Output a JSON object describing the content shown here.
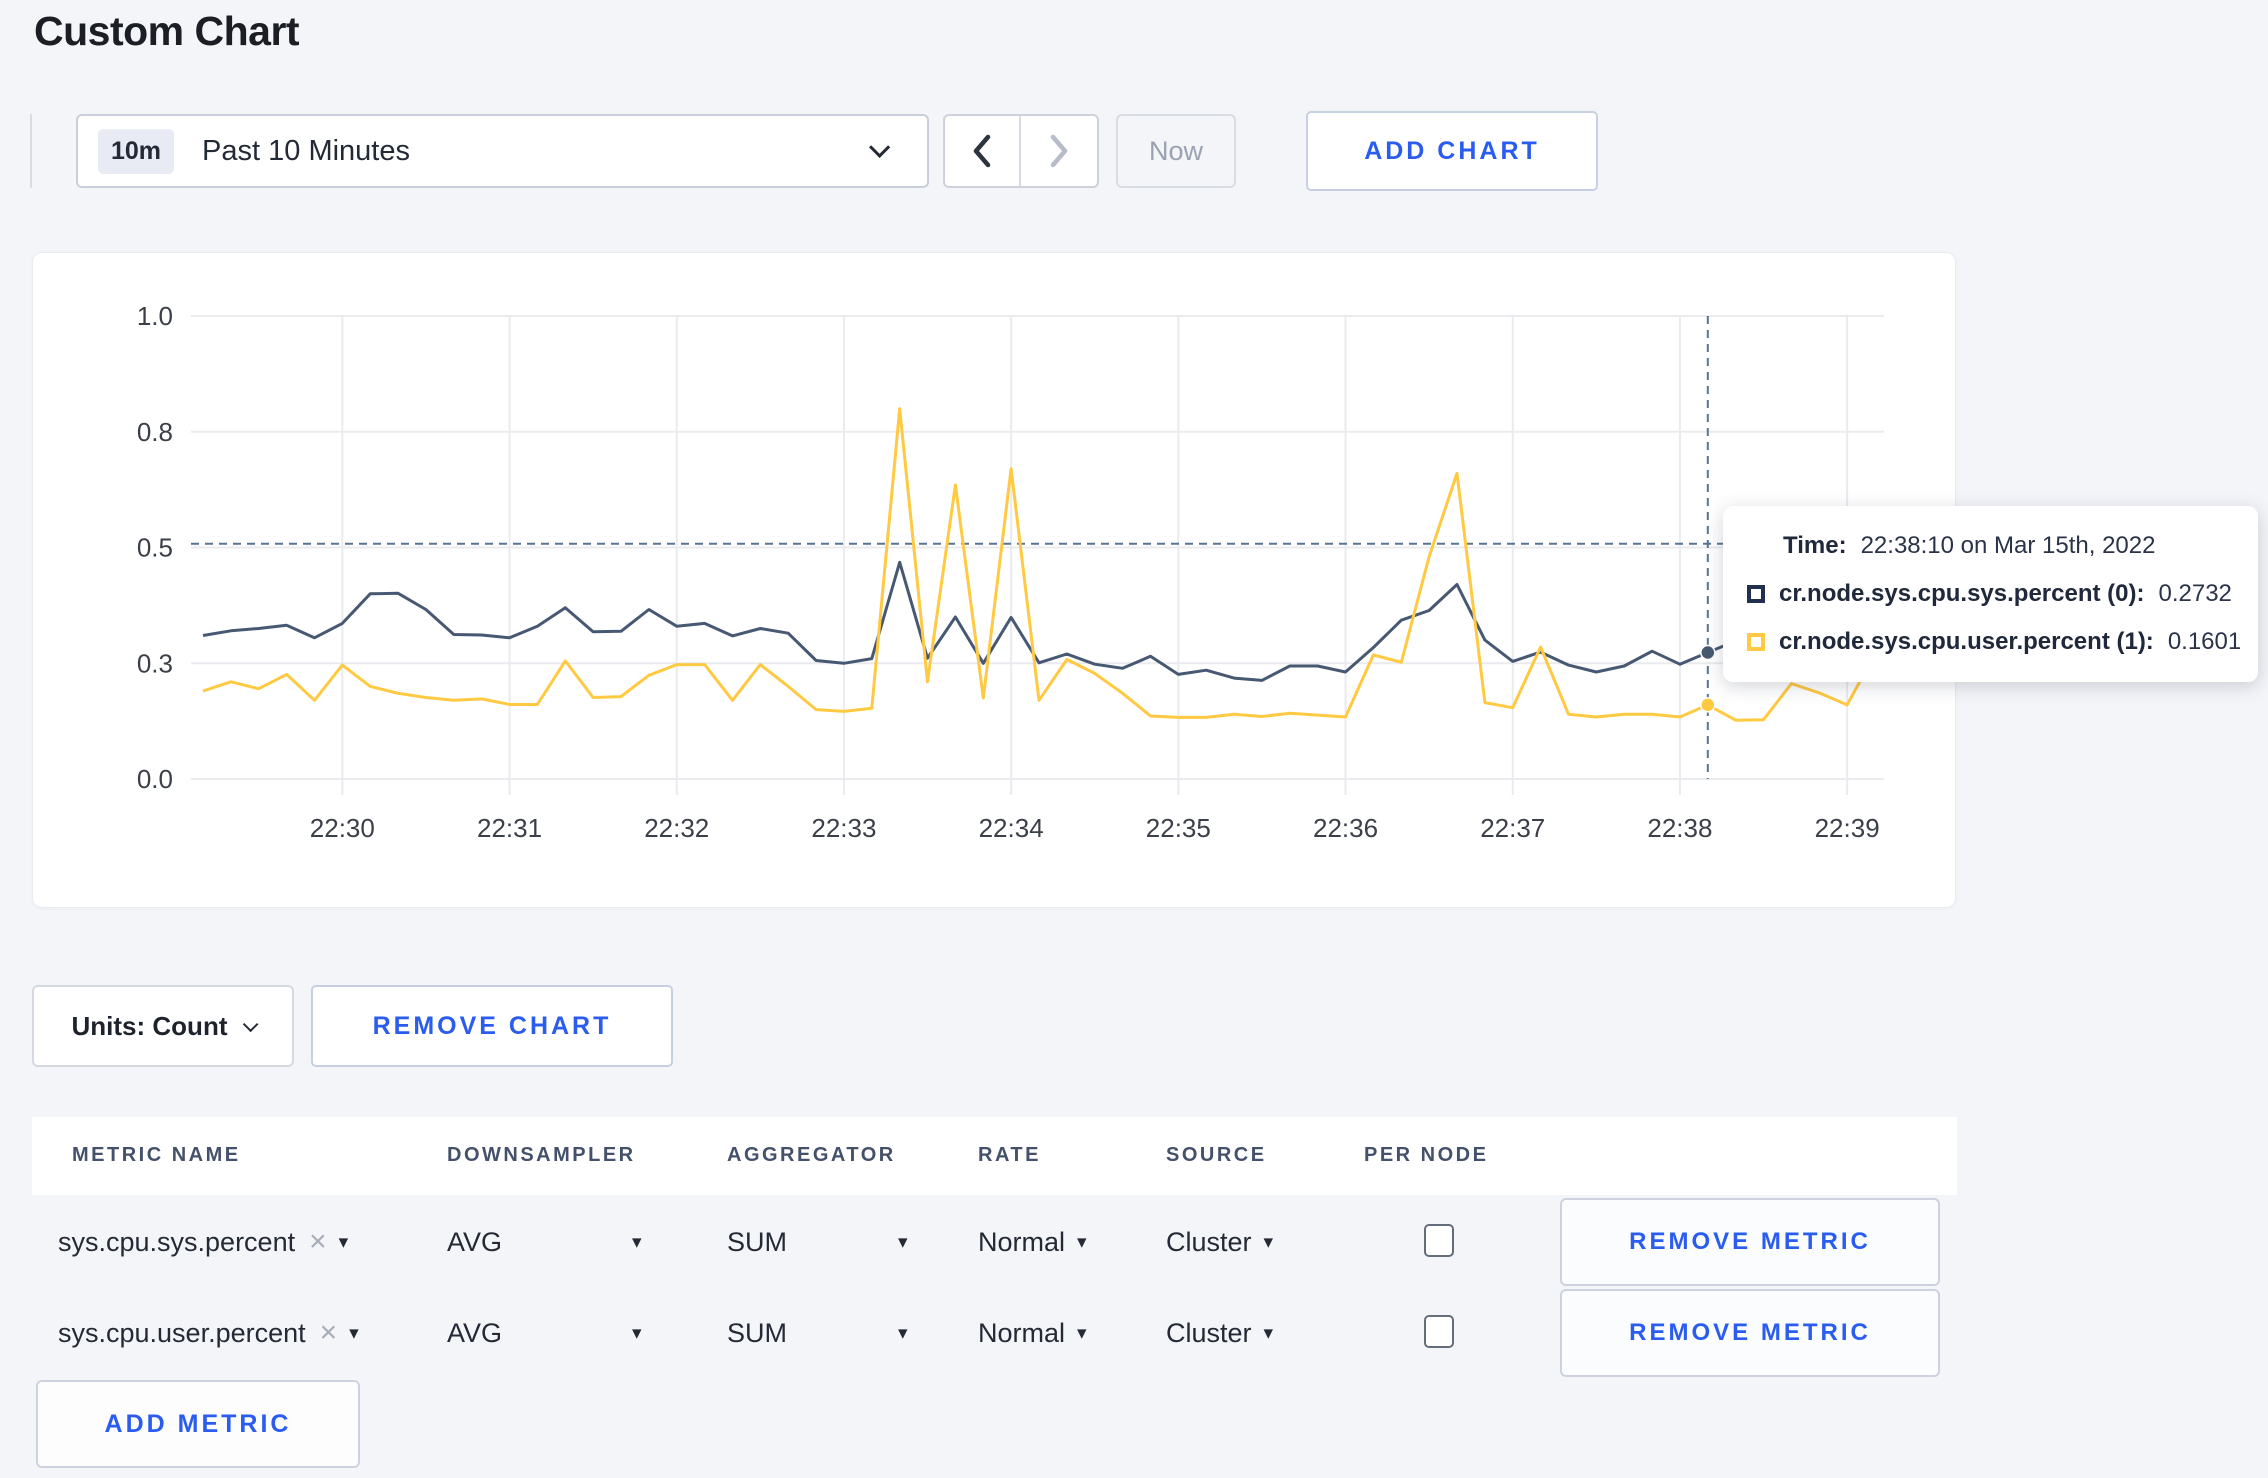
{
  "page": {
    "title": "Custom Chart"
  },
  "toolbar": {
    "time_badge": "10m",
    "time_label": "Past 10 Minutes",
    "now_label": "Now",
    "add_chart_label": "ADD CHART"
  },
  "chart_footer": {
    "units_label": "Units: Count",
    "remove_chart_label": "REMOVE CHART"
  },
  "tooltip": {
    "time_label": "Time:",
    "time_value": "22:38:10 on Mar 15th, 2022",
    "rows": [
      {
        "label": "cr.node.sys.cpu.sys.percent (0):",
        "value": "0.2732"
      },
      {
        "label": "cr.node.sys.cpu.user.percent (1):",
        "value": "0.1601"
      }
    ]
  },
  "chart_data": {
    "type": "line",
    "title": "",
    "xlabel": "",
    "ylabel": "",
    "ylim": [
      0,
      1
    ],
    "grid": true,
    "legend_position": "tooltip-only",
    "x_start_label": "22:29:10",
    "x_step_seconds": 10,
    "t_min": -50,
    "t_max": 550,
    "x_ticks": [
      "22:30",
      "22:31",
      "22:32",
      "22:33",
      "22:34",
      "22:35",
      "22:36",
      "22:37",
      "22:38",
      "22:39"
    ],
    "y_tick_labels": [
      "0.0",
      "0.3",
      "0.5",
      "0.8",
      "1.0"
    ],
    "y_tick_positions": [
      0,
      0.25,
      0.5,
      0.75,
      1
    ],
    "colors": {
      "grid": "#e9ebef",
      "crosshair": "#567595",
      "axis_text": "#3a3f48"
    },
    "crosshair": {
      "t": 490,
      "time": "22:38:10",
      "h_value": 0.508
    },
    "series": [
      {
        "name": "cr.node.sys.cpu.sys.percent (0)",
        "color": "#475872",
        "values": [
          0.31,
          0.32,
          0.325,
          0.332,
          0.305,
          0.336,
          0.4,
          0.401,
          0.366,
          0.312,
          0.311,
          0.305,
          0.33,
          0.37,
          0.318,
          0.319,
          0.366,
          0.33,
          0.336,
          0.309,
          0.325,
          0.315,
          0.256,
          0.25,
          0.26,
          0.468,
          0.261,
          0.35,
          0.25,
          0.349,
          0.251,
          0.27,
          0.248,
          0.239,
          0.265,
          0.226,
          0.235,
          0.218,
          0.213,
          0.244,
          0.244,
          0.231,
          0.284,
          0.343,
          0.364,
          0.42,
          0.3,
          0.254,
          0.274,
          0.246,
          0.231,
          0.244,
          0.276,
          0.248,
          0.2732,
          0.298,
          0.302,
          0.31,
          0.3,
          0.296,
          0.302
        ]
      },
      {
        "name": "cr.node.sys.cpu.user.percent (1)",
        "color": "#ffc942",
        "values": [
          0.19,
          0.21,
          0.195,
          0.226,
          0.17,
          0.246,
          0.2,
          0.185,
          0.176,
          0.17,
          0.173,
          0.161,
          0.161,
          0.255,
          0.176,
          0.178,
          0.224,
          0.247,
          0.247,
          0.17,
          0.247,
          0.2,
          0.15,
          0.146,
          0.153,
          0.8,
          0.21,
          0.635,
          0.175,
          0.67,
          0.17,
          0.258,
          0.228,
          0.185,
          0.136,
          0.133,
          0.133,
          0.14,
          0.135,
          0.142,
          0.138,
          0.134,
          0.268,
          0.252,
          0.48,
          0.66,
          0.165,
          0.154,
          0.285,
          0.14,
          0.134,
          0.14,
          0.14,
          0.134,
          0.1601,
          0.127,
          0.128,
          0.206,
          0.186,
          0.16,
          0.27
        ]
      }
    ]
  },
  "table": {
    "headers": [
      "METRIC NAME",
      "DOWNSAMPLER",
      "AGGREGATOR",
      "RATE",
      "SOURCE",
      "PER NODE"
    ],
    "remove_metric_label": "REMOVE METRIC",
    "add_metric_label": "ADD METRIC",
    "metrics": [
      {
        "name": "sys.cpu.sys.percent",
        "downsampler": "AVG",
        "aggregator": "SUM",
        "rate": "Normal",
        "source": "Cluster",
        "per_node": false
      },
      {
        "name": "sys.cpu.user.percent",
        "downsampler": "AVG",
        "aggregator": "SUM",
        "rate": "Normal",
        "source": "Cluster",
        "per_node": false
      }
    ]
  }
}
